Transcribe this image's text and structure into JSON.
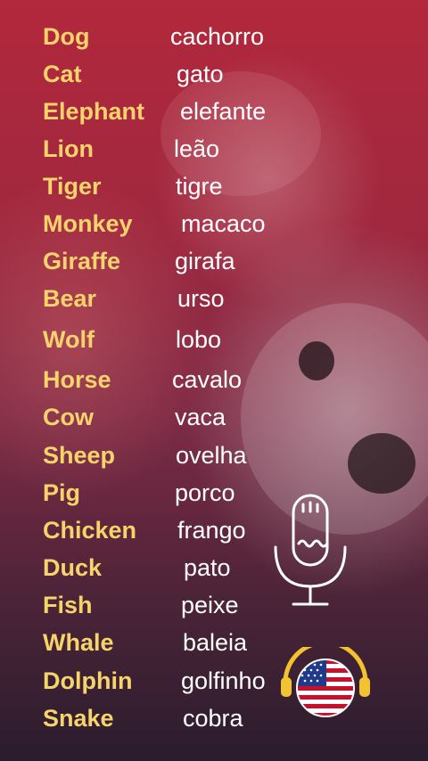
{
  "vocab": [
    {
      "en": "Dog",
      "pt": "cachorro"
    },
    {
      "en": "Cat",
      "pt": "gato"
    },
    {
      "en": "Elephant",
      "pt": "elefante"
    },
    {
      "en": "Lion",
      "pt": "leão"
    },
    {
      "en": "Tiger",
      "pt": "tigre"
    },
    {
      "en": "Monkey",
      "pt": "macaco"
    },
    {
      "en": "Giraffe",
      "pt": "girafa"
    },
    {
      "en": "Bear",
      "pt": "urso"
    },
    {
      "en": "Wolf",
      "pt": "lobo"
    },
    {
      "en": "Horse",
      "pt": "cavalo"
    },
    {
      "en": "Cow",
      "pt": "vaca"
    },
    {
      "en": "Sheep",
      "pt": "ovelha"
    },
    {
      "en": "Pig",
      "pt": "porco"
    },
    {
      "en": "Chicken",
      "pt": "frango"
    },
    {
      "en": "Duck",
      "pt": "pato"
    },
    {
      "en": "Fish",
      "pt": "peixe"
    },
    {
      "en": "Whale",
      "pt": "baleia"
    },
    {
      "en": "Dolphin",
      "pt": "golfinho"
    },
    {
      "en": "Snake",
      "pt": "cobra"
    }
  ],
  "icons": {
    "microphone": "microphone-icon",
    "flag": "us-flag-headphones-icon"
  },
  "colors": {
    "english_word": "#f7d46b",
    "portuguese_word": "#ffffff",
    "headphones": "#f2c230"
  }
}
